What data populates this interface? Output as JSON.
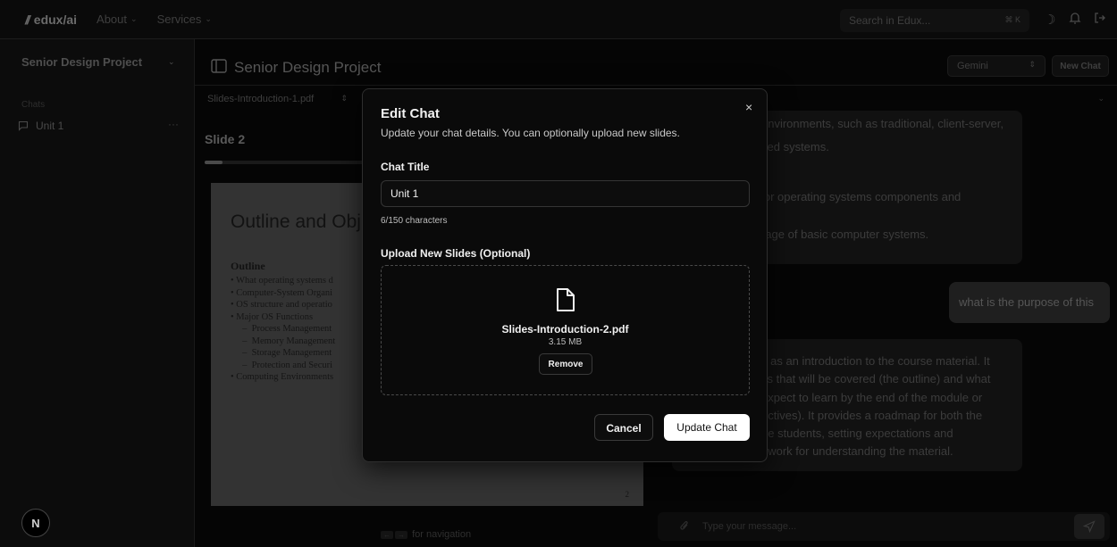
{
  "topnav": {
    "brand": "edux/ai",
    "brand_mark": "//",
    "links": [
      "About",
      "Services"
    ],
    "search_placeholder": "Search in Edux...",
    "search_shortcut": "⌘ K"
  },
  "sidebar": {
    "project": "Senior Design Project",
    "section_label": "Chats",
    "chats": [
      {
        "title": "Unit 1"
      }
    ],
    "avatar_letter": "N"
  },
  "header": {
    "title": "Senior Design Project",
    "model": "Gemini",
    "new_chat": "New Chat"
  },
  "slides_panel": {
    "file": "Slides-Introduction-1.pdf",
    "slide_label": "Slide 2",
    "progress": 0.04,
    "nav_hint": "for navigation",
    "nav_keys": [
      "←",
      "→"
    ],
    "slide": {
      "title": "Outline and Obj",
      "subtitle": "Outline",
      "items": [
        "•  What operating systems d",
        "•  Computer-System Organi",
        "•  OS structure and operatio",
        "•  Major OS Functions",
        "     –  Process Management",
        "     –  Memory Management",
        "     –  Storage Management",
        "     –  Protection and Securi",
        "•  Computing Environments"
      ],
      "page_number": "2"
    }
  },
  "chat_panel": {
    "assistant_1": [
      "environments, such as traditional, client-server,",
      "sed systems.",
      "jor operating systems components and",
      "rage of basic computer systems."
    ],
    "user_message": "what is the purpose of this",
    "assistant_2": [
      "s as an introduction to the course material. It",
      "cs that will be covered (the outline) and what",
      "expect to learn by the end of the module or",
      "ectives). It provides a roadmap for both the",
      "he students, setting expectations and",
      "ework for understanding the material."
    ],
    "composer_placeholder": "Type your message..."
  },
  "modal": {
    "title": "Edit Chat",
    "description": "Update your chat details. You can optionally upload new slides.",
    "title_label": "Chat Title",
    "title_value": "Unit 1",
    "char_count": "6/150 characters",
    "upload_label": "Upload New Slides (Optional)",
    "file_name": "Slides-Introduction-2.pdf",
    "file_size": "3.15 MB",
    "remove": "Remove",
    "cancel": "Cancel",
    "submit": "Update Chat",
    "close_glyph": "×"
  }
}
